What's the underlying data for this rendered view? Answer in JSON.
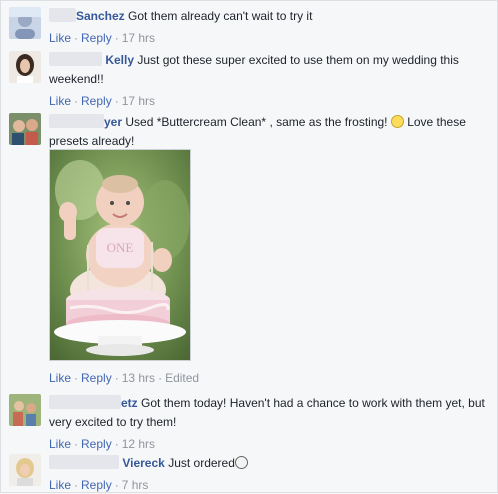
{
  "comments": [
    {
      "name": "Sanchez",
      "text": "Got them already can't wait to try it",
      "like": "Like",
      "reply": "Reply",
      "time": "17 hrs"
    },
    {
      "name": "Kelly",
      "text": "Just got these super excited to use them on my wedding this weekend!!",
      "like": "Like",
      "reply": "Reply",
      "time": "17 hrs"
    },
    {
      "name": "yer",
      "text": "Used *Buttercream Clean* , same as the frosting!",
      "text2": "Love these presets already!",
      "like": "Like",
      "reply": "Reply",
      "time": "13 hrs",
      "edited": "Edited"
    },
    {
      "name": "etz",
      "text": "Got them today! Haven't had a chance to work with them yet, but very excited to try them!",
      "like": "Like",
      "reply": "Reply",
      "time": "12 hrs"
    },
    {
      "name": "Viereck",
      "text": "Just ordered",
      "like": "Like",
      "reply": "Reply",
      "time": "7 hrs"
    }
  ],
  "icons": {
    "smile": "smiley-emoji-icon",
    "grin": "grinning-emoji-icon"
  }
}
